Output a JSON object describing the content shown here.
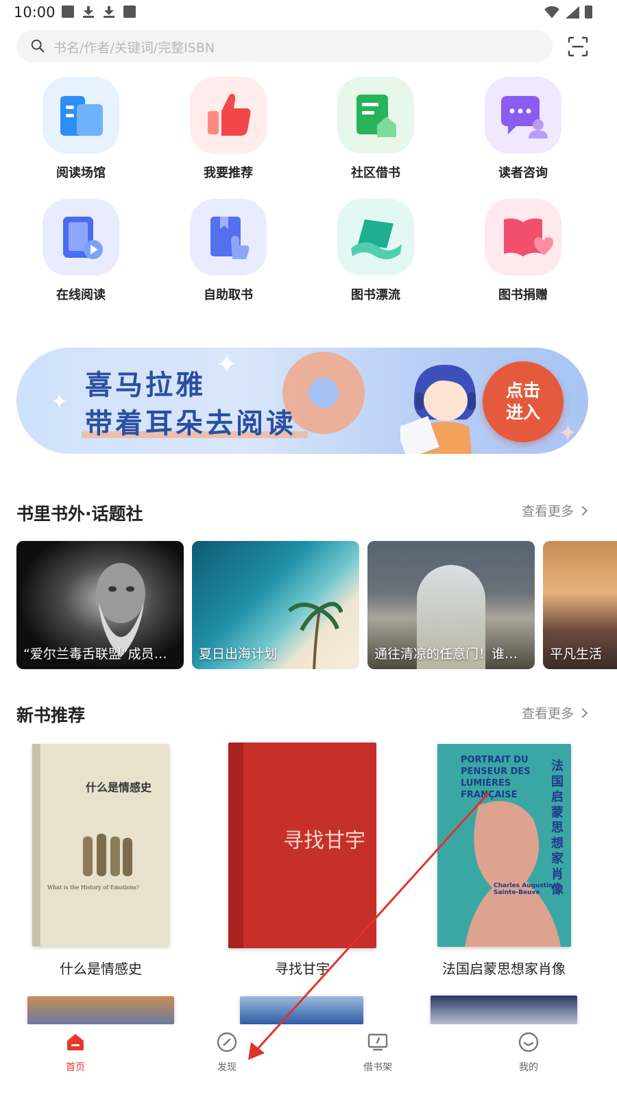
{
  "status_bar": {
    "time": "10:00"
  },
  "search": {
    "placeholder": "书名/作者/关键词/完整ISBN"
  },
  "grid": {
    "items": [
      {
        "label": "阅读场馆",
        "icon": "reading-venue-icon"
      },
      {
        "label": "我要推荐",
        "icon": "thumbs-up-icon"
      },
      {
        "label": "社区借书",
        "icon": "community-borrow-icon"
      },
      {
        "label": "读者咨询",
        "icon": "chat-consult-icon"
      },
      {
        "label": "在线阅读",
        "icon": "online-reading-icon"
      },
      {
        "label": "自助取书",
        "icon": "self-pickup-icon"
      },
      {
        "label": "图书漂流",
        "icon": "book-drift-icon"
      },
      {
        "label": "图书捐赠",
        "icon": "book-donation-icon"
      }
    ]
  },
  "banner": {
    "line1": "喜马拉雅",
    "line2": "带着耳朵去阅读",
    "cta_line1": "点击",
    "cta_line2": "进入"
  },
  "topics_section": {
    "title": "书里书外·话题社",
    "more": "查看更多",
    "cards": [
      {
        "label": "“爱尔兰毒舌联盟”成员…"
      },
      {
        "label": "夏日出海计划"
      },
      {
        "label": "通往清凉的任意门！谁…"
      },
      {
        "label": "平凡生活"
      }
    ]
  },
  "new_books_section": {
    "title": "新书推荐",
    "more": "查看更多",
    "books": [
      {
        "title": "什么是情感史",
        "cover_text": "什么是情感史",
        "cover_sub": "What is the History of Emotions?"
      },
      {
        "title": "寻找甘宇",
        "cover_text": "寻找甘宇"
      },
      {
        "title": "法国启蒙思想家肖像",
        "cover_text": "法国启蒙思想家肖像",
        "cover_en": "PORTRAIT DU PENSEUR DES LUMIÈRES FRANÇAISE",
        "cover_author": "Charles Augustin Sainte-Beuve"
      }
    ]
  },
  "bottom_nav": {
    "items": [
      {
        "label": "首页",
        "icon": "home-icon",
        "active": true
      },
      {
        "label": "发现",
        "icon": "compass-icon",
        "active": false
      },
      {
        "label": "借书架",
        "icon": "bookshelf-icon",
        "active": false
      },
      {
        "label": "我的",
        "icon": "smile-profile-icon",
        "active": false
      }
    ]
  },
  "colors": {
    "accent": "#e8362d",
    "annotation_arrow": "#e0322b",
    "banner_text": "#2b4ea3"
  }
}
